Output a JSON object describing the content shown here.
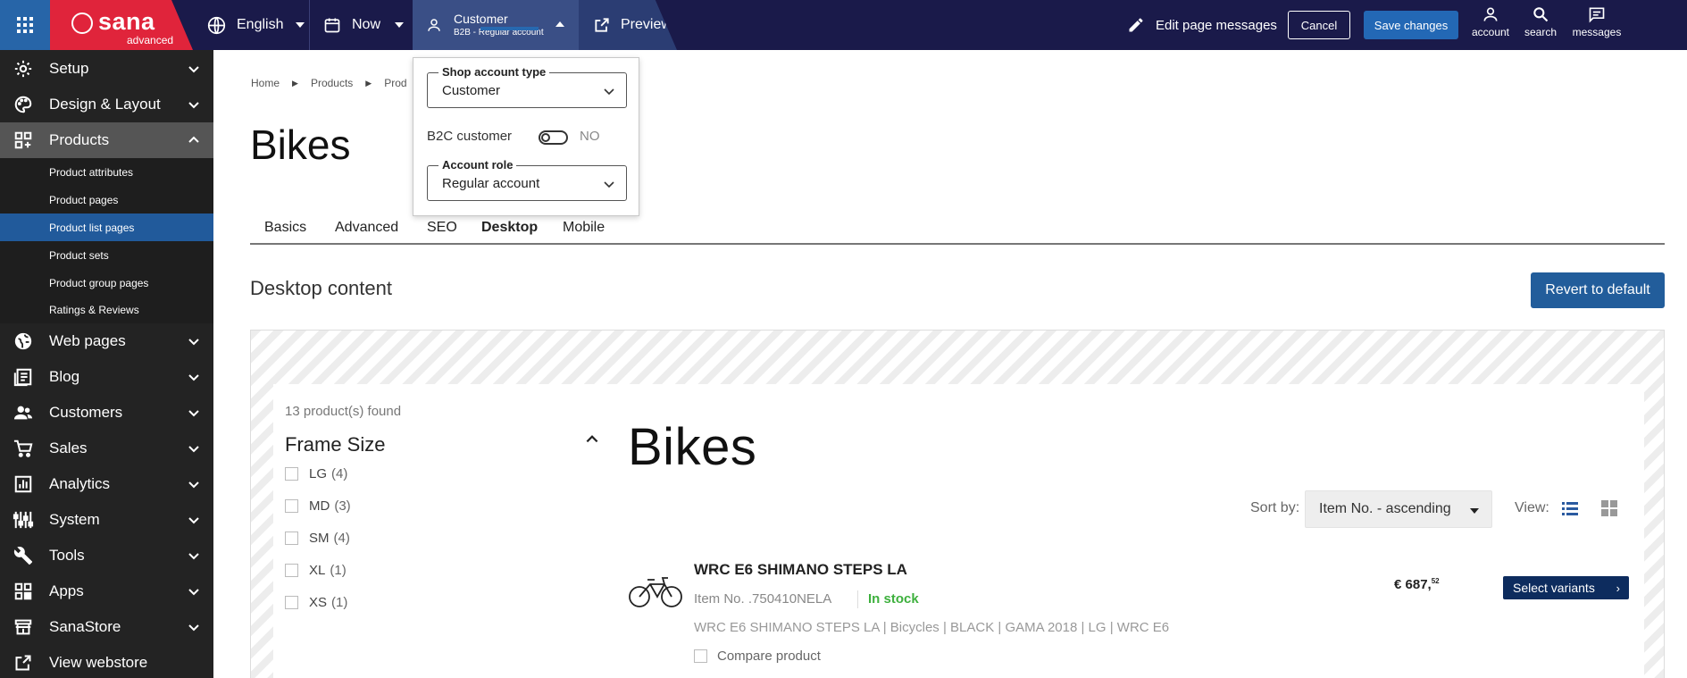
{
  "topbar": {
    "logo_name": "sana",
    "logo_sub": "advanced",
    "language": "English",
    "date": "Now",
    "customer_title": "Customer",
    "customer_sub": "B2B - Regular account",
    "preview": "Preview",
    "edit_messages": "Edit page messages",
    "cancel": "Cancel",
    "save": "Save changes",
    "account": "account",
    "search": "search",
    "messages": "messages",
    "colors": {
      "bar": "#1a1a4a",
      "brand": "#e0243b",
      "accent": "#2368b5"
    }
  },
  "sidebar": {
    "items": [
      {
        "label": "Setup",
        "icon": "gear-icon"
      },
      {
        "label": "Design & Layout",
        "icon": "palette-icon"
      },
      {
        "label": "Products",
        "icon": "products-icon"
      },
      {
        "label": "Web pages",
        "icon": "globe-icon"
      },
      {
        "label": "Blog",
        "icon": "blog-icon"
      },
      {
        "label": "Customers",
        "icon": "customers-icon"
      },
      {
        "label": "Sales",
        "icon": "cart-icon"
      },
      {
        "label": "Analytics",
        "icon": "analytics-icon"
      },
      {
        "label": "System",
        "icon": "system-icon"
      },
      {
        "label": "Tools",
        "icon": "wrench-icon"
      },
      {
        "label": "Apps",
        "icon": "apps-icon"
      },
      {
        "label": "SanaStore",
        "icon": "store-icon"
      },
      {
        "label": "View webstore",
        "icon": "external-link-icon"
      }
    ],
    "sub_items": [
      "Product attributes",
      "Product pages",
      "Product list pages",
      "Product sets",
      "Product group pages",
      "Ratings & Reviews"
    ]
  },
  "breadcrumb": [
    "Home",
    "Products",
    "Prod"
  ],
  "page_title": "Bikes",
  "tabs": [
    "Basics",
    "Advanced",
    "SEO",
    "Desktop",
    "Mobile"
  ],
  "section_title": "Desktop content",
  "revert_label": "Revert to default",
  "popup": {
    "shop_account_type_label": "Shop account type",
    "shop_account_type_value": "Customer",
    "b2c_label": "B2C customer",
    "b2c_state": "NO",
    "b2c_enabled": false,
    "account_role_label": "Account role",
    "account_role_value": "Regular account"
  },
  "plp": {
    "found": "13 product(s) found",
    "facet_title": "Frame Size",
    "facets": [
      {
        "label": "LG",
        "count": "(4)"
      },
      {
        "label": "MD",
        "count": "(3)"
      },
      {
        "label": "SM",
        "count": "(4)"
      },
      {
        "label": "XL",
        "count": "(1)"
      },
      {
        "label": "XS",
        "count": "(1)"
      }
    ],
    "title": "Bikes",
    "sort_label": "Sort by:",
    "sort_value": "Item No. - ascending",
    "view_label": "View:",
    "product": {
      "name": "WRC E6 SHIMANO STEPS LA",
      "item_no": "Item No.  .750410NELA",
      "stock": "In stock",
      "description": "WRC E6 SHIMANO STEPS LA | Bicycles | BLACK | GAMA 2018 | LG | WRC E6",
      "compare": "Compare product",
      "price_main": "€ 687,",
      "price_cents": "52",
      "select_variants": "Select variants"
    }
  }
}
